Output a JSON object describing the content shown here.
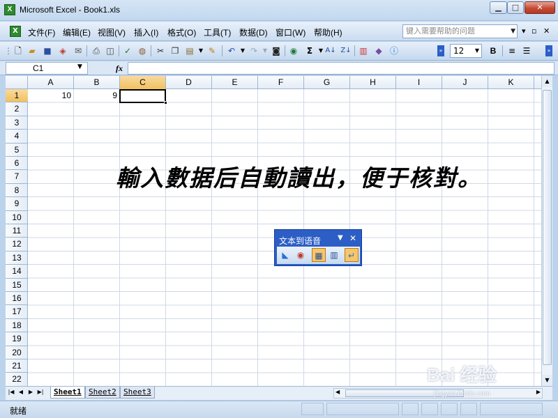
{
  "window": {
    "app_icon": "X",
    "title": "Microsoft Excel - Book1.xls",
    "min_glyph": "▁",
    "max_glyph": "□",
    "close_glyph": "✕"
  },
  "menu": {
    "items": [
      "文件(F)",
      "编辑(E)",
      "视图(V)",
      "插入(I)",
      "格式(O)",
      "工具(T)",
      "数据(D)",
      "窗口(W)",
      "帮助(H)"
    ],
    "help_placeholder": "键入需要帮助的问题",
    "mdi_min": "▾",
    "mdi_restore": "▫",
    "mdi_close": "✕"
  },
  "toolbar": {
    "icons": [
      "new-icon",
      "open-icon",
      "save-icon",
      "permission-icon",
      "email-icon",
      "print-icon",
      "print-preview-icon",
      "spelling-icon",
      "research-icon",
      "cut-icon",
      "copy-icon",
      "paste-icon",
      "format-painter-icon",
      "undo-icon",
      "redo-icon",
      "camera-icon",
      "hyperlink-icon",
      "autosum-icon",
      "sort-asc-icon",
      "sort-desc-icon",
      "chart-wizard-icon",
      "drawing-icon",
      "help-icon"
    ],
    "font_size": "12",
    "bold_label": "B"
  },
  "formula_bar": {
    "name_box": "C1",
    "fx": "fx",
    "formula": ""
  },
  "grid": {
    "columns": [
      "A",
      "B",
      "C",
      "D",
      "E",
      "F",
      "G",
      "H",
      "I",
      "J",
      "K"
    ],
    "rows": [
      "1",
      "2",
      "3",
      "4",
      "5",
      "6",
      "7",
      "8",
      "9",
      "10",
      "11",
      "12",
      "13",
      "14",
      "15",
      "16",
      "17",
      "18",
      "19",
      "20",
      "21",
      "22"
    ],
    "active_column": "C",
    "active_row": "1",
    "cells": {
      "A1": "10",
      "B1": "9"
    }
  },
  "overlay_text": "輸入數据后自動讀出，便于核對。",
  "tts_toolbar": {
    "title": "文本到语音",
    "buttons": [
      "speak-cells-icon",
      "stop-speaking-icon",
      "by-rows-icon",
      "by-columns-icon",
      "speak-on-enter-icon"
    ]
  },
  "sheets": [
    "Sheet1",
    "Sheet2",
    "Sheet3"
  ],
  "status": "就绪",
  "watermark": {
    "main": "Bai 经验",
    "sub": "jingyan.baidu.com"
  },
  "colors": {
    "accent": "#2c5ec6",
    "active_header": "#f1c15f",
    "grid_line": "#d0d7e5"
  }
}
